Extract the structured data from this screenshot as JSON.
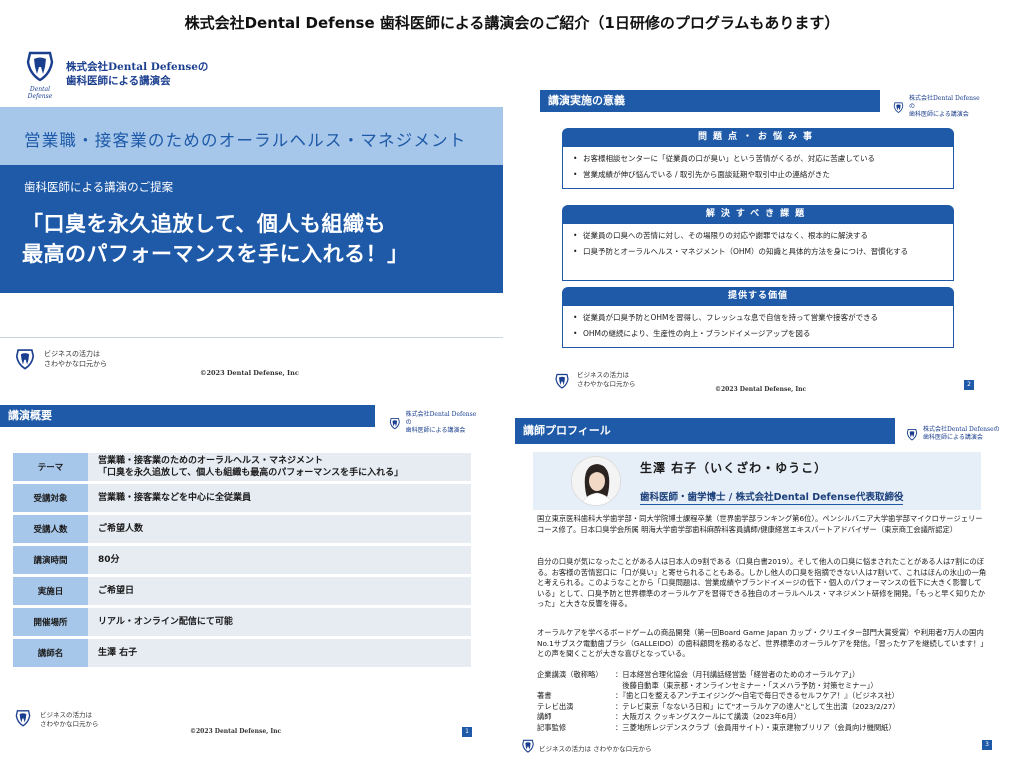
{
  "page_title": "株式会社Dental Defense 歯科医師による講演会のご紹介（1日研修のプログラムもあります）",
  "brand": {
    "logo_text": "Dental Defense",
    "company_line1": "株式会社Dental Defenseの",
    "company_line2": "歯科医師による講演会",
    "tagline_line1": "ビジネスの活力は",
    "tagline_line2": "さわやかな口元から",
    "copyright": "©2023 Dental Defense, Inc",
    "primary_color": "#1e5aa8",
    "light_color": "#a7c7ea"
  },
  "slide1": {
    "band_title": "営業職・接客業のためのオーラルヘルス・マネジメント",
    "subtitle": "歯科医師による講演のご提案",
    "headline_line1": "「口臭を永久追放して、個人も組織も",
    "headline_line2": "最高のパフォーマンスを手に入れる！」"
  },
  "slide2": {
    "header": "講演実施の意義",
    "page_number": "2",
    "boxes": [
      {
        "title": "問題点・お悩み事",
        "items": [
          "お客様相談センターに「従業員の口が臭い」という苦情がくるが、対応に苦慮している",
          "営業成績が伸び悩んでいる / 取引先から面談延期や取引中止の連絡がきた"
        ]
      },
      {
        "title": "解決すべき課題",
        "items": [
          "従業員の口臭への苦情に対し、その場限りの対応や謝罪ではなく、根本的に解決する",
          "口臭予防とオーラルヘルス・マネジメント（OHM）の知識と具体的方法を身につけ、習慣化する"
        ]
      },
      {
        "title": "提供する価値",
        "items": [
          "従業員が口臭予防とOHMを習得し、フレッシュな息で自信を持って営業や接客ができる",
          "OHMの継続により、生産性の向上・ブランドイメージアップを図る"
        ]
      }
    ]
  },
  "slide3": {
    "header": "講演概要",
    "page_number": "1",
    "rows": [
      {
        "label": "テーマ",
        "value1": "営業職・接客業のためのオーラルヘルス・マネジメント",
        "value2": "「口臭を永久追放して、個人も組織も最高のパフォーマンスを手に入れる」"
      },
      {
        "label": "受講対象",
        "value1": "営業職・接客業などを中心に全従業員",
        "value2": ""
      },
      {
        "label": "受講人数",
        "value1": "ご希望人数",
        "value2": ""
      },
      {
        "label": "講演時間",
        "value1": "80分",
        "value2": ""
      },
      {
        "label": "実施日",
        "value1": "ご希望日",
        "value2": ""
      },
      {
        "label": "開催場所",
        "value1": "リアル・オンライン配信にて可能",
        "value2": ""
      },
      {
        "label": "講師名",
        "value1": "生澤 右子",
        "value2": ""
      }
    ]
  },
  "slide4": {
    "header": "講師プロフィール",
    "page_number": "3",
    "name": "生澤 右子（いくざわ・ゆうこ）",
    "title": "歯科医師・歯学博士 / 株式会社Dental Defense代表取締役",
    "para1": "国立東京医科歯科大学歯学部・同大学院博士課程卒業（世界歯学部ランキング第6位）。ペンシルバニア大学歯学部マイクロサージェリーコース修了。日本口臭学会所属 明海大学歯学部歯科麻酔科客員講師/健康経営エキスパートアドバイザー（東京商工会議所認定）",
    "para2": "自分の口臭が気になったことがある人は日本人の9割である（口臭白書2019）。そして他人の口臭に悩まされたことがある人は7割にのぼる。お客様の苦情窓口に「口が臭い」と寄せられることもある。しかし他人の口臭を指摘できない人は7割いて、これはほんの氷山の一角と考えられる。このようなことから「口臭問題は、営業成績やブランドイメージの低下・個人のパフォーマンスの低下に大きく影響している」として、口臭予防と世界標準のオーラルケアを習得できる独自のオーラルヘルス・マネジメント研修を開発。「もっと早く知りたかった」と大きな反響を得る。",
    "para3": "オーラルケアを学べるボードゲームの商品開発（第一回Board Game Japan カップ・クリエイター部門大賞受賞）や利用者7万人の国内No.1サブスク電動歯ブラシ（GALLEIDO）の歯科顧問を務めるなど、世界標準のオーラルケアを発信。「習ったケアを継続しています！」との声を聞くことが大きな喜びとなっている。",
    "activities": [
      {
        "key": "企業講演（敬称略）",
        "value": "：日本経営合理化協会（月刊講話経営塾「経営者のためのオーラルケア」）"
      },
      {
        "key": "",
        "value": "　後藤自動車（東京都・オンラインセミナー・「スメハラ予防・対策セミナー」）"
      },
      {
        "key": "著書",
        "value": "：『歯と口を整えるアンチエイジング〜自宅で毎日できるセルフケア！』（ビジネス社）"
      },
      {
        "key": "テレビ出演",
        "value": "：テレビ東京「なないろ日和」にて\"オーラルケアの達人\"として生出演（2023/2/27）"
      },
      {
        "key": "講師",
        "value": "：大阪ガス クッキングスクールにて講演（2023年6月）"
      },
      {
        "key": "記事監修",
        "value": "：三菱地所レジデンスクラブ（会員用サイト）・東京建物ブリリア（会員向け機関紙）"
      }
    ],
    "footer": "ビジネスの活力は さわやかな口元から"
  }
}
